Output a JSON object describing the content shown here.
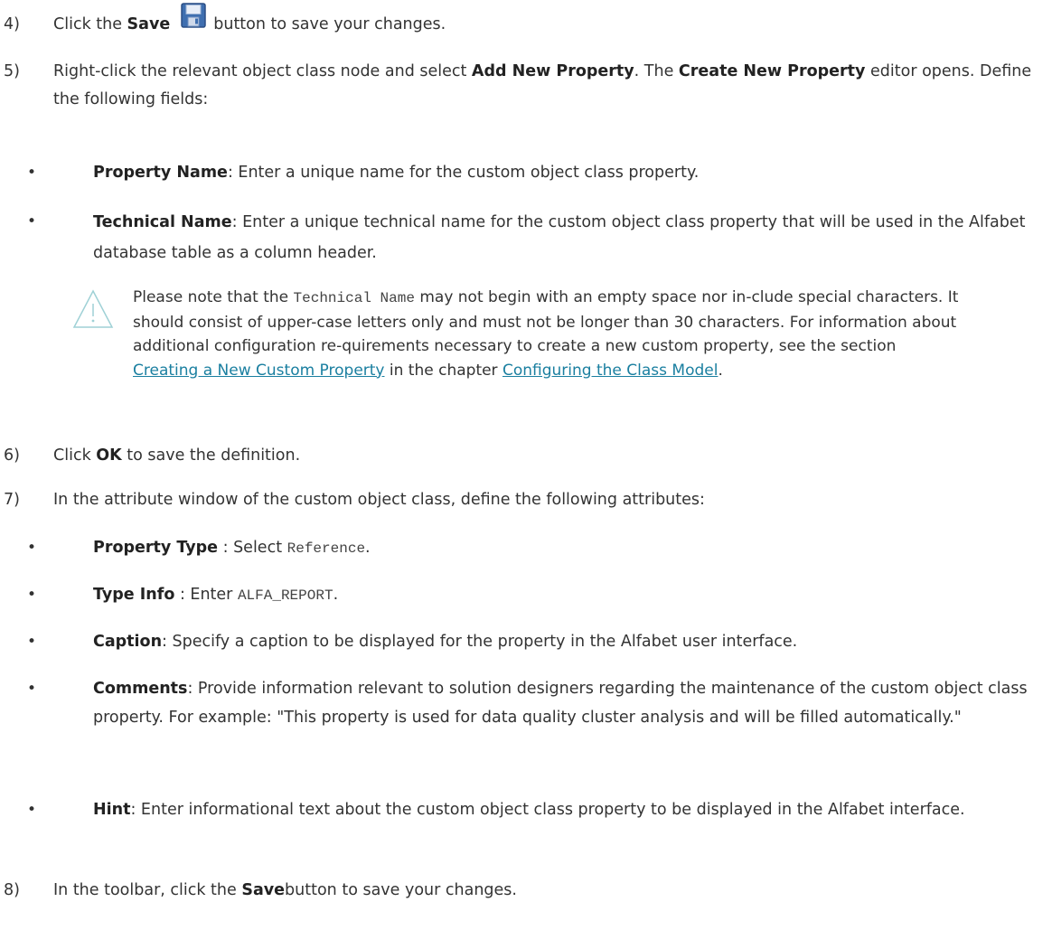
{
  "steps": {
    "s4": {
      "num": "4)",
      "pre": "Click the ",
      "bold": "Save",
      "post": "button to save your changes."
    },
    "s5": {
      "num": "5)",
      "p1": "Right-click the relevant object class node and select ",
      "b1": "Add New Property",
      "p2": ". The ",
      "b2": "Create New Property",
      "p3": " editor opens. Define the following fields:"
    },
    "s6": {
      "num": "6)",
      "pre": "Click ",
      "bold": "OK",
      "post": " to save the definition."
    },
    "s7": {
      "num": "7)",
      "text": "In the attribute window of the custom object class, define the following attributes:"
    },
    "s8": {
      "num": "8)",
      "pre": "In the toolbar, click the ",
      "bold": "Save",
      "post": "button to save your changes."
    }
  },
  "bullets5": [
    {
      "label": "Property Name",
      "text": ": Enter a unique name for the custom object class property."
    },
    {
      "label": "Technical Name",
      "text": ": Enter a unique technical name for the custom object class property that will be used in the Alfabet database table as a column header."
    }
  ],
  "note": {
    "t1": "Please note that the ",
    "code": "Technical Name",
    "t2": " may not begin with an empty space nor in-clude special characters. It should consist of upper-case letters only and must not be longer than 30 characters. For information about additional configuration re-quirements necessary to create a new custom property, see the section ",
    "link1": "Creating a New Custom Property",
    "t3": " in the chapter ",
    "link2": "Configuring the Class Model",
    "t4": "."
  },
  "bullets7": [
    {
      "label": "Property Type",
      "pre": " : Select ",
      "code": "Reference",
      "post": "."
    },
    {
      "label": "Type Info",
      "pre": " : Enter ",
      "code": "ALFA_REPORT",
      "post": "."
    },
    {
      "label": "Caption",
      "text": ": Specify a caption to be displayed for the property in the Alfabet user interface."
    },
    {
      "label": "Comments",
      "text": ": Provide information relevant to solution designers regarding the maintenance of the custom object class property. For example: \"This property is used for data quality cluster analysis and will be filled automatically.\""
    },
    {
      "label": "Hint",
      "text": ": Enter informational text about the custom object class property to be displayed in the Alfabet interface."
    }
  ],
  "icons": {
    "save": "floppy-disk-icon",
    "warning": "warning-triangle-icon"
  },
  "colors": {
    "link": "#1a7fa0",
    "text": "#333333"
  }
}
